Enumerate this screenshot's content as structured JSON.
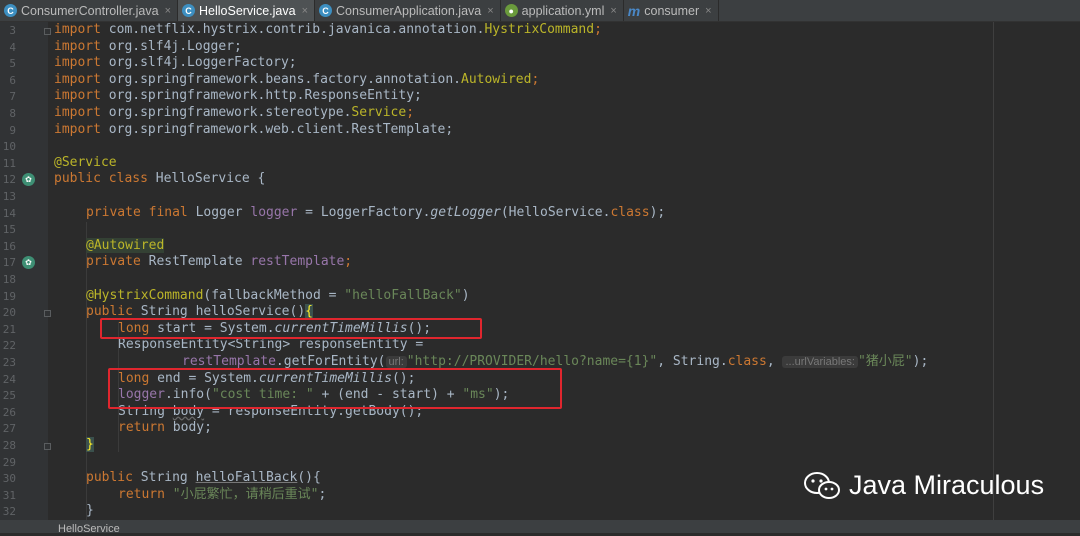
{
  "tabs": [
    {
      "label": "ConsumerController.java",
      "icon": "java-class-icon",
      "active": false
    },
    {
      "label": "HelloService.java",
      "icon": "java-class-icon",
      "active": true
    },
    {
      "label": "ConsumerApplication.java",
      "icon": "spring-app-icon",
      "active": false
    },
    {
      "label": "application.yml",
      "icon": "yml-file-icon",
      "active": false
    },
    {
      "label": "consumer",
      "icon": "maven-icon",
      "active": false
    }
  ],
  "close_glyph": "×",
  "line_numbers": [
    "3",
    "4",
    "5",
    "6",
    "7",
    "8",
    "9",
    "10",
    "11",
    "12",
    "13",
    "14",
    "15",
    "16",
    "17",
    "18",
    "19",
    "20",
    "21",
    "22",
    "23",
    "24",
    "25",
    "26",
    "27",
    "28",
    "29",
    "30",
    "31",
    "32"
  ],
  "code": {
    "l3": {
      "kw": "import",
      "pkg": " com.netflix.hystrix.contrib.javanica.annotation.",
      "cls": "HystrixCommand",
      "semi": ";"
    },
    "l4": {
      "kw": "import",
      "rest": " org.slf4j.Logger;"
    },
    "l5": {
      "kw": "import",
      "rest": " org.slf4j.LoggerFactory;"
    },
    "l6": {
      "kw": "import",
      "pkg": " org.springframework.beans.factory.annotation.",
      "cls": "Autowired",
      "semi": ";"
    },
    "l7": {
      "kw": "import",
      "rest": " org.springframework.http.ResponseEntity;"
    },
    "l8": {
      "kw": "import",
      "pkg": " org.springframework.stereotype.",
      "cls": "Service",
      "semi": ";"
    },
    "l9": {
      "kw": "import",
      "rest": " org.springframework.web.client.RestTemplate;"
    },
    "l11": {
      "ann": "@Service"
    },
    "l12": {
      "kw": "public class",
      "rest": " HelloService {"
    },
    "l14": {
      "kw": "private final",
      "t1": " Logger ",
      "f": "logger",
      "t2": " = LoggerFactory.",
      "m": "getLogger",
      "t3": "(HelloService.",
      "k2": "class",
      "t4": ");"
    },
    "l16": {
      "ann": "@Autowired"
    },
    "l17": {
      "kw": "private",
      "t1": " RestTemplate ",
      "f": "restTemplate",
      "t2": ";"
    },
    "l19": {
      "ann": "@HystrixCommand",
      "t1": "(fallbackMethod = ",
      "s": "\"helloFallBack\"",
      "t2": ")"
    },
    "l20": {
      "kw": "public",
      "t1": " String helloService()",
      "brace": "{"
    },
    "l21": {
      "kw": "long",
      "t1": " start = System.",
      "m": "currentTimeMillis",
      "t2": "();"
    },
    "l22": {
      "t1": "ResponseEntity<String> responseEntity ="
    },
    "l23": {
      "f": "restTemplate",
      "t1": ".getForEntity(",
      "h1": "url:",
      "s": "\"http://PROVIDER/hello?name={1}\"",
      "t2": ", String.",
      "k": "class",
      "t3": ", ",
      "h2": "...urlVariables:",
      "s2": "\"猪小屁\"",
      "t4": ");"
    },
    "l24": {
      "kw": "long",
      "t1": " end = System.",
      "m": "currentTimeMillis",
      "t2": "();"
    },
    "l25": {
      "f": "logger",
      "t1": ".info(",
      "s": "\"cost time: \"",
      "t2": " + (end - start) + ",
      "s2": "\"ms\"",
      "t3": ");"
    },
    "l26": {
      "t1": "String ",
      "v": "body",
      "t2": " = responseEntity.getBody();"
    },
    "l27": {
      "kw": "return",
      "t1": " body;"
    },
    "l28": {
      "brace": "}"
    },
    "l30": {
      "kw": "public",
      "t1": " String ",
      "m": "helloFallBack",
      "t2": "(){"
    },
    "l31": {
      "kw": "return",
      "s": "\"小屁繁忙，请稍后重试\"",
      "t1": ";"
    },
    "l32": {
      "brace": "}"
    }
  },
  "status": {
    "breadcrumb": "HelloService"
  },
  "watermark": {
    "text": "Java Miraculous",
    "icon": "wechat-icon"
  },
  "colors": {
    "keyword": "#cc7832",
    "annotation": "#bbb529",
    "string": "#6a8759",
    "field": "#9876aa",
    "highlight_box": "#e0262e"
  }
}
